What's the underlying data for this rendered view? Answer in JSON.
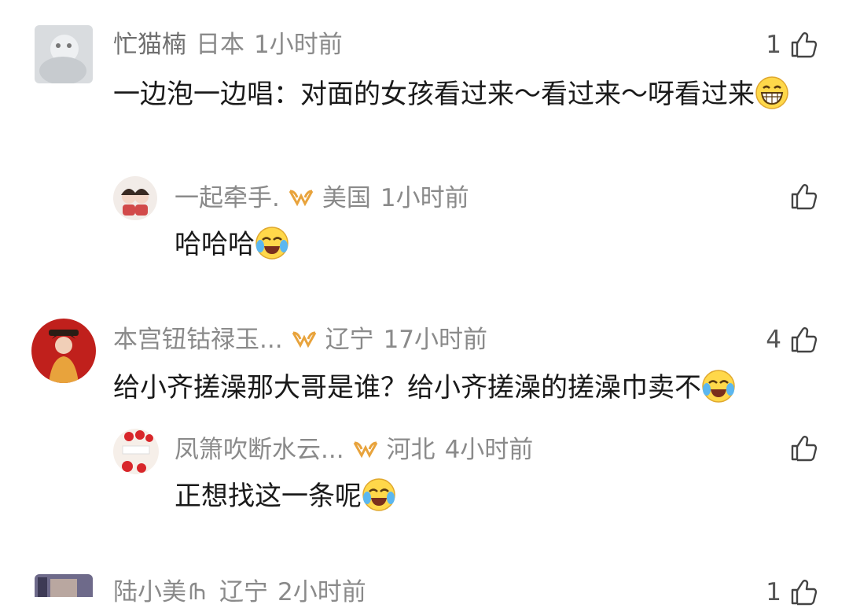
{
  "comments": [
    {
      "user": "忙猫楠",
      "location": "日本",
      "time": "1小时前",
      "likes": "1",
      "text": "一边泡一边唱：对面的女孩看过来～看过来～呀看过来",
      "emoji": "grin-emoji",
      "reply": {
        "user": "一起牵手.",
        "location": "美国",
        "time": "1小时前",
        "likes": "",
        "text": "哈哈哈",
        "emoji": "laugh-cry-emoji"
      }
    },
    {
      "user": "本宫钮钴禄玉...",
      "location": "辽宁",
      "time": "17小时前",
      "likes": "4",
      "text": "给小齐搓澡那大哥是谁？给小齐搓澡的搓澡巾卖不",
      "emoji": "laugh-cry-emoji",
      "reply": {
        "user": "凤箫吹断水云...",
        "location": "河北",
        "time": "4小时前",
        "likes": "",
        "text": "正想找这一条呢",
        "emoji": "laugh-cry-emoji"
      }
    },
    {
      "user": "陆小美",
      "location": "辽宁",
      "time": "2小时前",
      "likes": "1"
    }
  ],
  "colors": {
    "meta": "#8a8a8a",
    "vip_gold": "#e8a33c",
    "text": "#1a1a1a"
  }
}
